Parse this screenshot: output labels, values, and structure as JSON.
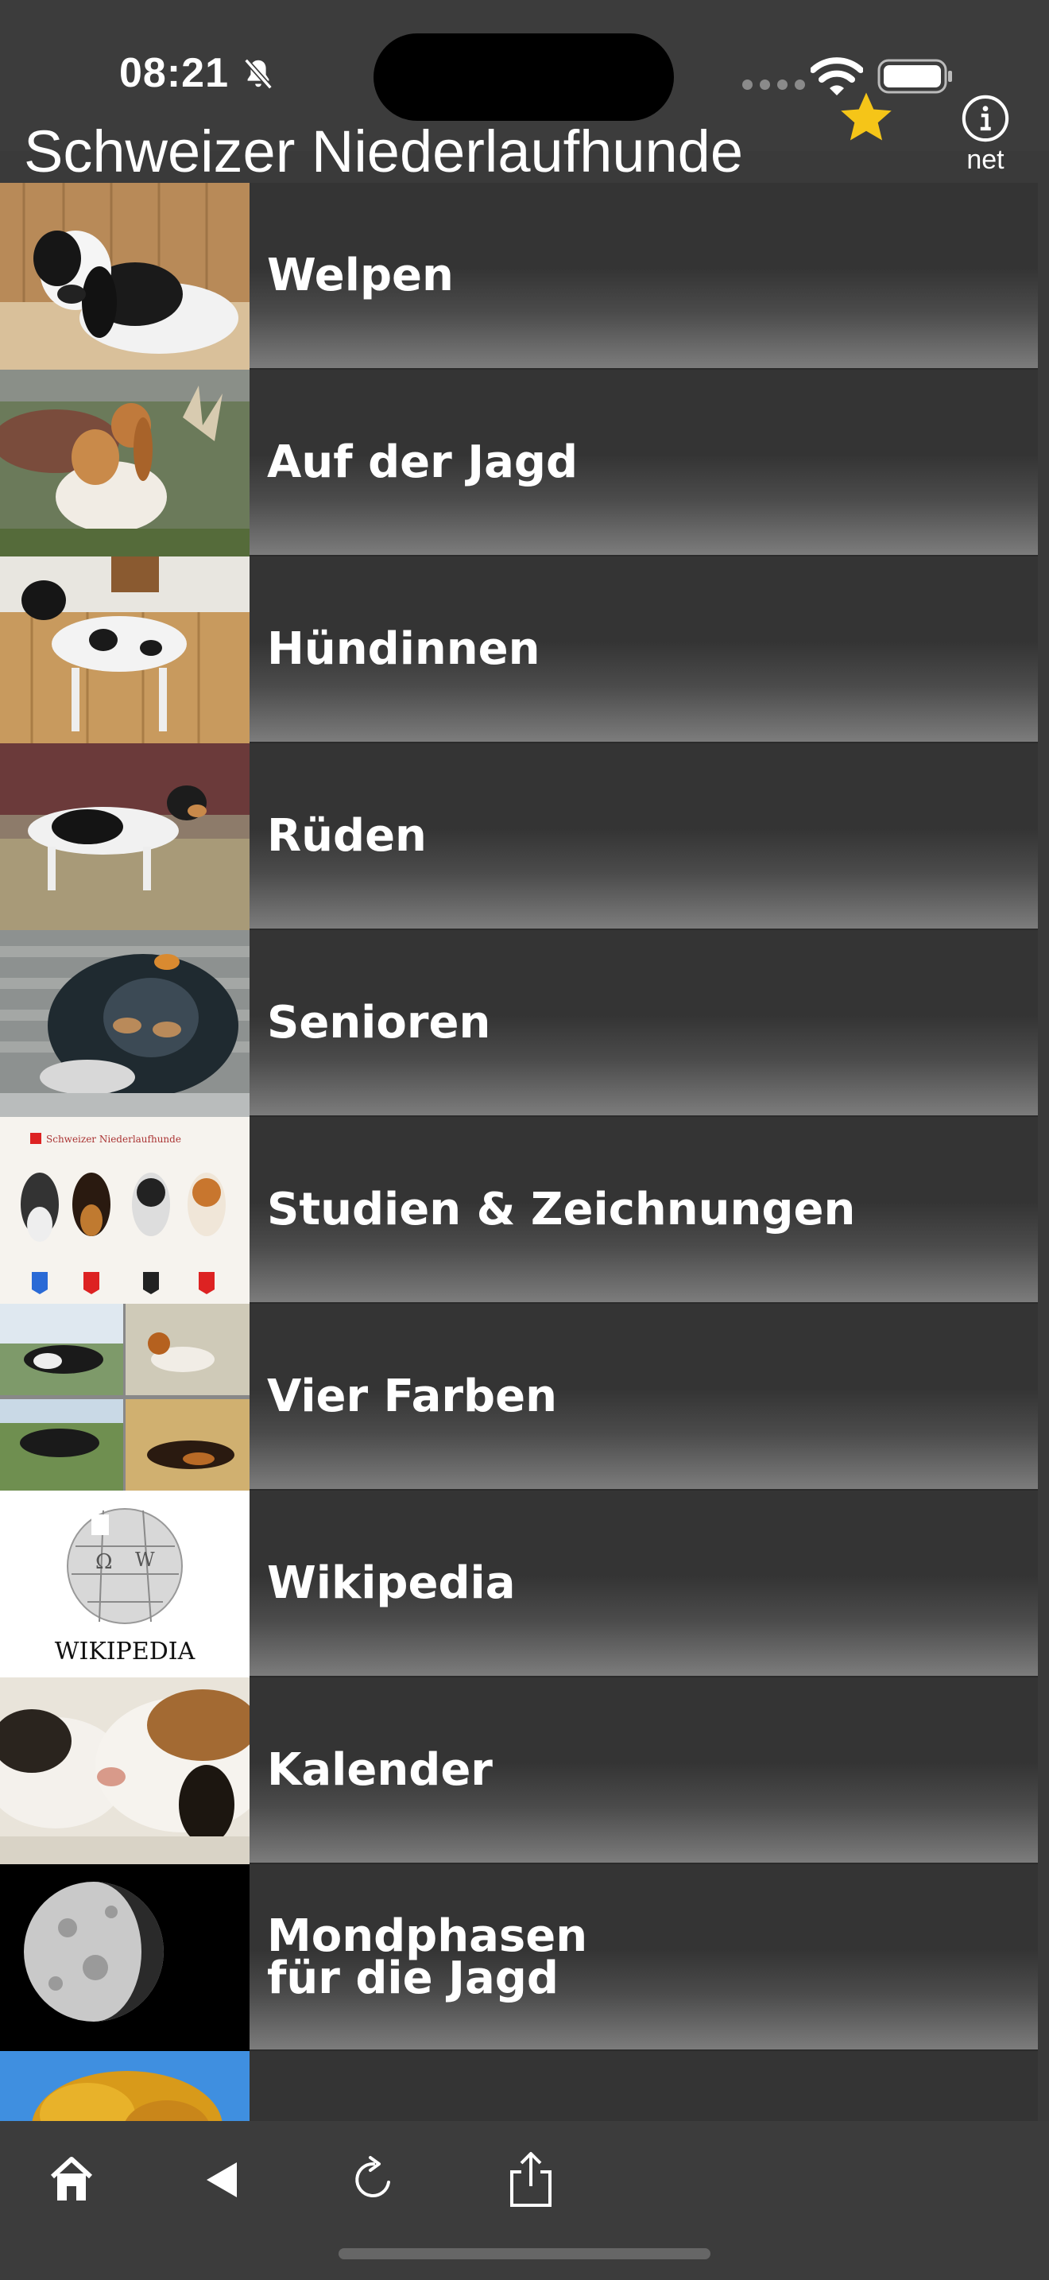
{
  "status_bar": {
    "time": "08:21"
  },
  "header": {
    "title": "Schweizer Niederlaufhunde",
    "info_label": "net"
  },
  "menu": [
    {
      "label": "Welpen",
      "thumb": "puppy-photo"
    },
    {
      "label": "Auf der Jagd",
      "thumb": "hunting-photo"
    },
    {
      "label": "Hündinnen",
      "thumb": "female-dog-photo"
    },
    {
      "label": "Rüden",
      "thumb": "male-dog-photo"
    },
    {
      "label": "Senioren",
      "thumb": "senior-dog-photo"
    },
    {
      "label": "Studien & Zeichnungen",
      "thumb": "drawings-image"
    },
    {
      "label": "Vier Farben",
      "thumb": "four-colors-collage"
    },
    {
      "label": "Wikipedia",
      "thumb": "wikipedia-logo"
    },
    {
      "label": "Kalender",
      "thumb": "sleeping-puppies-photo"
    },
    {
      "label": "Mondphasen\nfür die Jagd",
      "thumb": "moon-photo"
    },
    {
      "label": "",
      "thumb": "autumn-tree-photo"
    }
  ],
  "drawings_thumb_text": "Schweizer Niederlaufhunde",
  "wikipedia_thumb_text": "WIKIPEDIA",
  "toolbar": {
    "icons": [
      "home-icon",
      "back-icon",
      "reload-icon",
      "share-icon"
    ]
  },
  "colors": {
    "background": "#3a3a3a",
    "star": "#f5c518",
    "text": "#ffffff"
  }
}
